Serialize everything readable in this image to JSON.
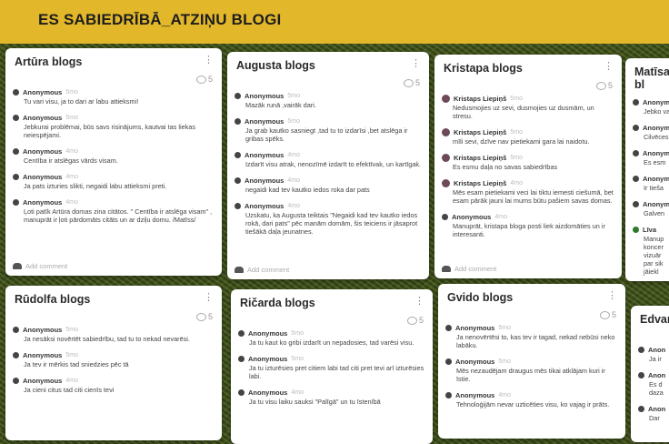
{
  "header": {
    "title": "ES SABIEDRĪBĀ_ATZIŅU BLOGI"
  },
  "labels": {
    "add_comment": "Add comment"
  },
  "columns": [
    {
      "title": "Artūra blogs",
      "comments": "5",
      "posts": [
        {
          "author": "Anonymous",
          "time": "5mo",
          "text": "Tu vari visu, ja to dari ar labu attieksmi!"
        },
        {
          "author": "Anonymous",
          "time": "5mo",
          "text": "Jebkurai problēmai, būs savs risinājums, kautvai tas liekas neiespējami."
        },
        {
          "author": "Anonymous",
          "time": "4mo",
          "text": "Centība ir atslēgas vārds visam."
        },
        {
          "author": "Anonymous",
          "time": "4mo",
          "text": "Ja pats izturies slikti, negaidi labu attieksmi preti."
        },
        {
          "author": "Anonymous",
          "time": "4mo",
          "text": "Ļoti patīk Artūra domas zina citātos. \" Centība ir atslēga visam\" , manuprāt ir ļoti pārdomāts citāts un ar dziļu domu. /Matīss/"
        }
      ]
    },
    {
      "title": "Augusta blogs",
      "comments": "5",
      "posts": [
        {
          "author": "Anonymous",
          "time": "5mo",
          "text": "Mazāk runā ,vairāk dari."
        },
        {
          "author": "Anonymous",
          "time": "5mo",
          "text": "Ja grab kautko sasniegt ,tad tu to izdarīsi ,bet atslēga ir gribas spēks."
        },
        {
          "author": "Anonymous",
          "time": "4mo",
          "text": "Izdarīt visu atrak, nenozīmē izdarīt to efektīvak, un kartīgak."
        },
        {
          "author": "Anonymous",
          "time": "4mo",
          "text": "negaidi kad tev kautko iedos roka dar pats"
        },
        {
          "author": "Anonymous",
          "time": "4mo",
          "text": "Uzskatu, ka Augusta teiktais \"Negaidi kad tev kautko iedos rokā, dari pats\" pēc manām domām, šis teiciens ir jāsaprot tiešākā daļa jeunatnes."
        }
      ]
    },
    {
      "title": "Kristapa blogs",
      "comments": "5",
      "posts": [
        {
          "author": "Kristaps Liepiņš",
          "time": "5mo",
          "text": "Nedusmojies uz sevi, dusmojies uz dusmām, un stresu.",
          "kp": true
        },
        {
          "author": "Kristaps Liepiņš",
          "time": "5mo",
          "text": "mīli sevi, dzīve nav pietiekami gara lai naidotu.",
          "kp": true
        },
        {
          "author": "Kristaps Liepiņš",
          "time": "5mo",
          "text": "Es esmu daļa no savas sabiedrības",
          "kp": true
        },
        {
          "author": "Kristaps Liepiņš",
          "time": "4mo",
          "text": "Mēs esam pietiekami veci lai tiktu iemesti ciešumā, bet esam pārāk jauni lai mums būtu pašiem savas domas.",
          "kp": true
        },
        {
          "author": "Anonymous",
          "time": "4mo",
          "text": "Manuprāt, kristapa bloga posti liek aizdomāties un ir interesanti."
        }
      ]
    },
    {
      "title": "Matīsa bl",
      "posts": [
        {
          "author": "Anonym",
          "time": "",
          "text": "Jebko va"
        },
        {
          "author": "Anonym",
          "time": "",
          "text": "Cilvēces"
        },
        {
          "author": "Anonym",
          "time": "",
          "text": "Es esm"
        },
        {
          "author": "Anonym",
          "time": "",
          "text": "Ir tieša"
        },
        {
          "author": "Anonym",
          "time": "",
          "text": "Galven"
        },
        {
          "author": "Līva",
          "time": "",
          "text": "Manup koncer vizuār par sik jāiekl",
          "green": true
        }
      ]
    },
    {
      "title": "Rūdolfa blogs",
      "comments": "5",
      "posts": [
        {
          "author": "Anonymous",
          "time": "5mo",
          "text": "Ja nesāksi novērtēt sabiedrību, tad tu to nekad nevarēsi."
        },
        {
          "author": "Anonymous",
          "time": "5mo",
          "text": "Ja tev ir mērkis tad sniedzies pēc tā"
        },
        {
          "author": "Anonymous",
          "time": "4mo",
          "text": "Ja cieni citus tad citi cienīs tevi"
        }
      ]
    },
    {
      "title": "Ričarda blogs",
      "comments": "5",
      "posts": [
        {
          "author": "Anonymous",
          "time": "5mo",
          "text": "Ja tu kaut ko gribi izdarīt un nepadosies, tad varēsi visu."
        },
        {
          "author": "Anonymous",
          "time": "5mo",
          "text": "Ja tu izturēsies pret citiem labi tad citi pret tevi arī izturēsies labi."
        },
        {
          "author": "Anonymous",
          "time": "4mo",
          "text": "Ja tu visu laiku sauksi \"Palīgā\" un tu īstenībā"
        }
      ]
    },
    {
      "title": "Gvido blogs",
      "comments": "5",
      "posts": [
        {
          "author": "Anonymous",
          "time": "5mo",
          "text": "Ja nenovērtēsi to, kas tev ir tagad, nekad nebūsi neko labāku."
        },
        {
          "author": "Anonymous",
          "time": "5mo",
          "text": "Mēs nezaudējam draugus mēs tikai atklājam kuri ir īstie."
        },
        {
          "author": "Anonymous",
          "time": "4mo",
          "text": "Tehnoloģijām nevar uzticēties visu, ko vajag ir prāts."
        }
      ]
    },
    {
      "title": "Edvard",
      "posts": [
        {
          "author": "Anon",
          "time": "",
          "text": "Ja ir"
        },
        {
          "author": "Anon",
          "time": "",
          "text": "Es d daza"
        },
        {
          "author": "Anon",
          "time": "",
          "text": "Dar"
        }
      ]
    }
  ]
}
